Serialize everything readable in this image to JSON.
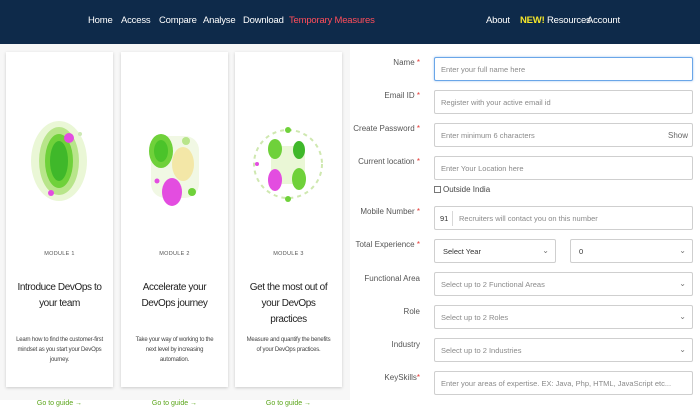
{
  "nav": {
    "left": [
      "Home",
      "Access",
      "Compare",
      "Analyse",
      "Download",
      "Temporary Measures"
    ],
    "right": {
      "about": "About",
      "new_badge": "NEW!",
      "resources": "Resources",
      "account": "Account"
    },
    "active_color": "#ff4d5a",
    "bar_color": "#0e2a4a"
  },
  "cards": [
    {
      "tag": "MODULE 1",
      "title": "Introduce DevOps to your team",
      "desc": "Learn how to find the customer-first mindset as you start your DevOps journey.",
      "link": "Go to guide →"
    },
    {
      "tag": "MODULE 2",
      "title": "Accelerate your DevOps journey",
      "desc": "Take your way of working to the next level by increasing automation.",
      "link": "Go to guide →"
    },
    {
      "tag": "MODULE 3",
      "title": "Get the most out of your DevOps practices",
      "desc": "Measure and quantify the benefits of your DevOps practices.",
      "link": "Go to guide →"
    }
  ],
  "form": {
    "name": {
      "label": "Name",
      "placeholder": "Enter your full name here"
    },
    "email": {
      "label": "Email ID",
      "placeholder": "Register with your active email id"
    },
    "password": {
      "label": "Create Password",
      "placeholder": "Enter minimum 6 characters",
      "show": "Show"
    },
    "location": {
      "label": "Current location",
      "placeholder": "Enter Your Location here",
      "outside_india": "Outside India"
    },
    "mobile": {
      "label": "Mobile Number",
      "code": "91",
      "placeholder": "Recruiters will contact you on this number"
    },
    "experience": {
      "label": "Total Experience",
      "year": "Select Year",
      "month": "0"
    },
    "functional": {
      "label": "Functional Area",
      "placeholder": "Select up to 2 Functional Areas"
    },
    "role": {
      "label": "Role",
      "placeholder": "Select up to 2 Roles"
    },
    "industry": {
      "label": "Industry",
      "placeholder": "Select up to 2 Industries"
    },
    "keyskills": {
      "label": "KeySkills",
      "placeholder": "Enter your areas of expertise. EX: Java, Php, HTML, JavaScript etc..."
    },
    "required_mark": "*",
    "icons": {
      "dropdown": "chevron-down-icon"
    }
  }
}
